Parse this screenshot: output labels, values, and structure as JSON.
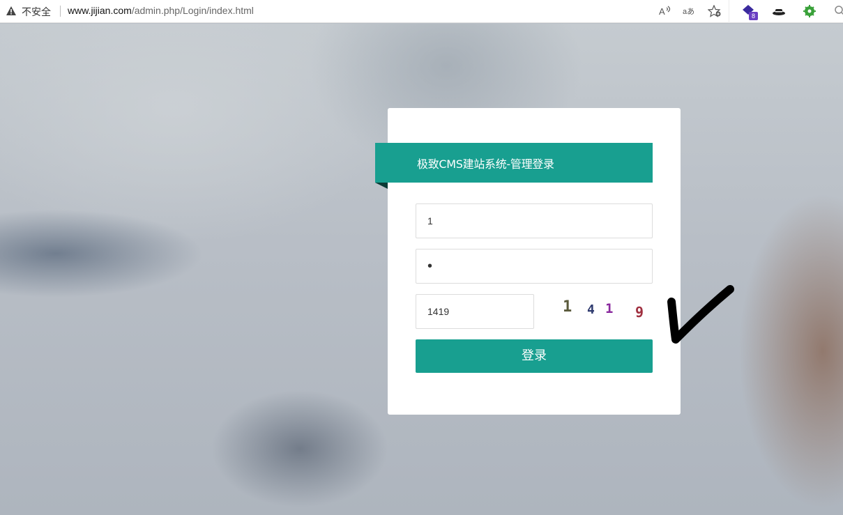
{
  "browser": {
    "security_label": "不安全",
    "url_host": "www.jijian.com",
    "url_path": "/admin.php/Login/index.html",
    "icons": [
      "warning-icon",
      "read-aloud-icon",
      "translate-icon",
      "favorites-add-icon",
      "extension-diamond-icon",
      "extension-hat-icon",
      "extension-gear-icon",
      "extension-profile-icon"
    ],
    "extension_badge": "8"
  },
  "login": {
    "title": "极致CMS建站系统-管理登录",
    "username_value": "1",
    "password_value": "•",
    "captcha_value": "1419",
    "captcha_chars": [
      "1",
      "4",
      "1",
      "9"
    ],
    "captcha_colors": [
      "#5a5a3c",
      "#2e3a6e",
      "#8a2a9e",
      "#a03040"
    ],
    "submit_label": "登录"
  },
  "theme": {
    "accent": "#189f90"
  }
}
